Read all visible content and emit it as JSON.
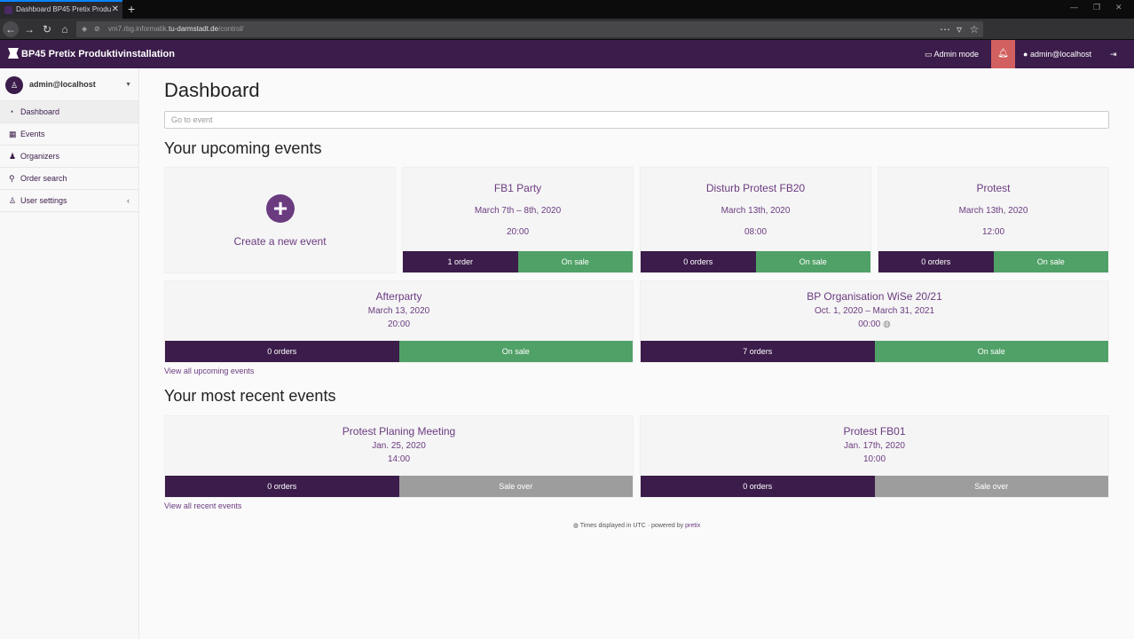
{
  "browser": {
    "tab_title": "Dashboard BP45 Pretix Produ",
    "url_prefix": "vm7.rbg.informatik.",
    "url_domain": "tu-darmstadt.de",
    "url_path": "/control/"
  },
  "header": {
    "brand": "BP45 Pretix Produktivinstallation",
    "admin_mode": "Admin mode",
    "user": "admin@localhost"
  },
  "sidebar": {
    "user": "admin@localhost",
    "items": [
      {
        "label": "Dashboard",
        "icon": "tachometer-icon"
      },
      {
        "label": "Events",
        "icon": "calendar-icon"
      },
      {
        "label": "Organizers",
        "icon": "users-icon"
      },
      {
        "label": "Order search",
        "icon": "search-icon"
      },
      {
        "label": "User settings",
        "icon": "user-icon"
      }
    ]
  },
  "main": {
    "title": "Dashboard",
    "goto_placeholder": "Go to event",
    "upcoming_heading": "Your upcoming events",
    "create_label": "Create a new event",
    "upcoming": [
      {
        "name": "FB1 Party",
        "date": "March 7th – 8th, 2020",
        "time": "20:00",
        "orders": "1 order",
        "status": "On sale"
      },
      {
        "name": "Disturb Protest FB20",
        "date": "March 13th, 2020",
        "time": "08:00",
        "orders": "0 orders",
        "status": "On sale"
      },
      {
        "name": "Protest",
        "date": "March 13th, 2020",
        "time": "12:00",
        "orders": "0 orders",
        "status": "On sale"
      },
      {
        "name": "Afterparty",
        "date": "March 13, 2020",
        "time": "20:00",
        "orders": "0 orders",
        "status": "On sale"
      },
      {
        "name": "BP Organisation WiSe 20/21",
        "date": "Oct. 1, 2020 – March 31, 2021",
        "time": "00:00",
        "orders": "7 orders",
        "status": "On sale"
      }
    ],
    "view_all_upcoming": "View all upcoming events",
    "recent_heading": "Your most recent events",
    "recent": [
      {
        "name": "Protest Planing Meeting",
        "date": "Jan. 25, 2020",
        "time": "14:00",
        "orders": "0 orders",
        "status": "Sale over"
      },
      {
        "name": "Protest FB01",
        "date": "Jan. 17th, 2020",
        "time": "10:00",
        "orders": "0 orders",
        "status": "Sale over"
      }
    ],
    "view_all_recent": "View all recent events",
    "footer_text": "Times displayed in UTC · powered by",
    "footer_link": "pretix"
  },
  "colors": {
    "brand": "#3b1c4a",
    "accent": "#6b3b80",
    "on_sale": "#50a167",
    "sale_over": "#9d9d9d",
    "notification": "#d36060"
  }
}
